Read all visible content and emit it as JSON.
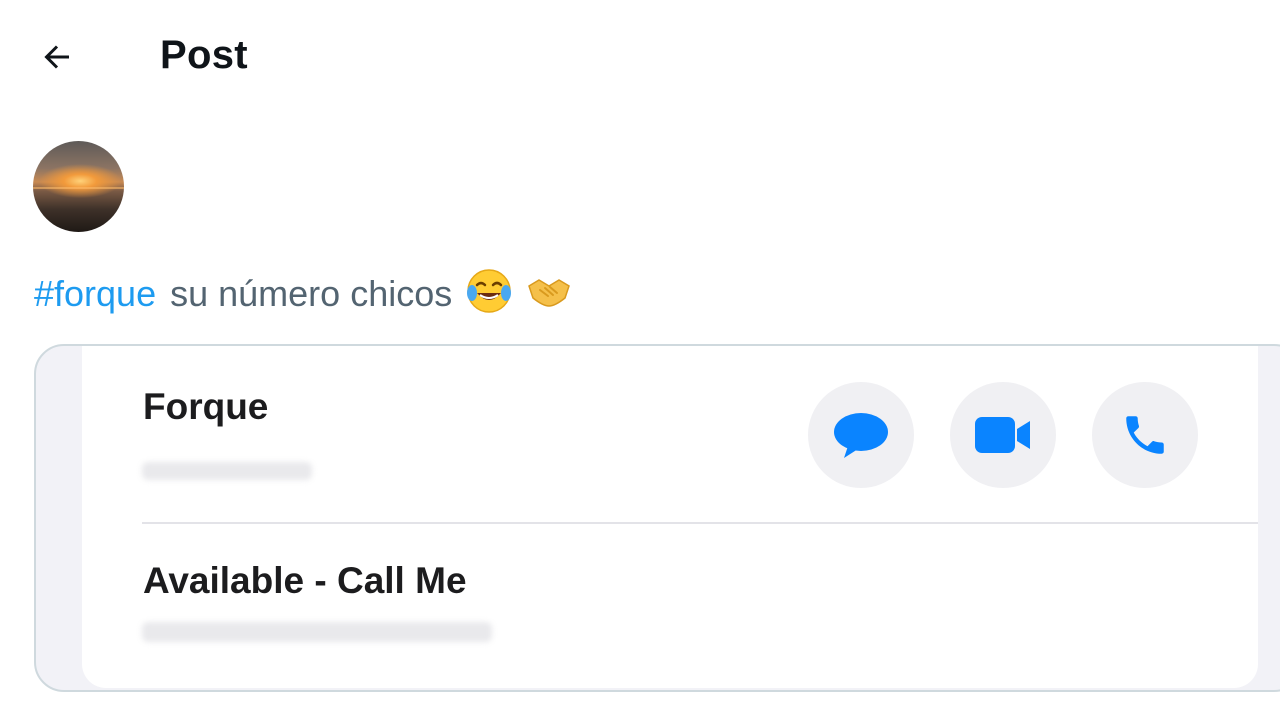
{
  "header": {
    "title": "Post",
    "back_icon": "arrow-left-icon"
  },
  "post": {
    "hashtag": "#forque",
    "text": "su número chicos",
    "emojis": [
      "face-with-tears-of-joy-icon",
      "handshake-icon"
    ]
  },
  "contact_card": {
    "name": "Forque",
    "status": "Available - Call Me",
    "actions": [
      {
        "name": "message",
        "icon": "message-bubble-icon"
      },
      {
        "name": "video",
        "icon": "video-camera-icon"
      },
      {
        "name": "call",
        "icon": "phone-icon"
      }
    ],
    "accent_color": "#0a84ff"
  },
  "colors": {
    "hashtag": "#1d9bf0",
    "text_secondary": "#536471",
    "card_border": "#cfd9de"
  }
}
